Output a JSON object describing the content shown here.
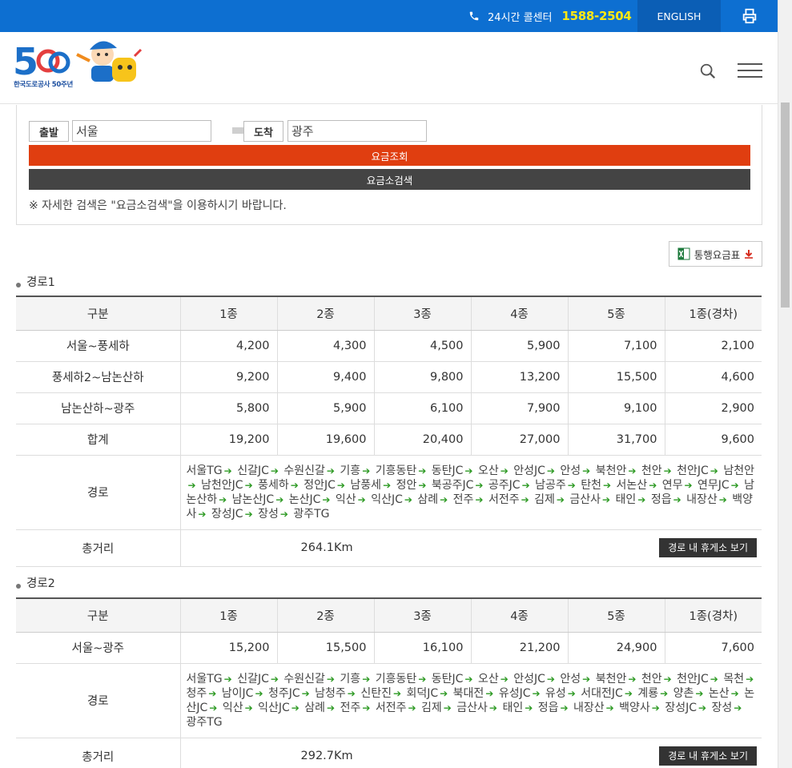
{
  "topbar": {
    "call_label": "24시간 콜센터",
    "call_number": "1588-2504",
    "english": "ENGLISH",
    "print_icon": "printer-icon"
  },
  "header": {
    "logo_alt": "한국도로공사 50주년",
    "search_icon": "search-icon",
    "menu_icon": "hamburger-menu-icon"
  },
  "search": {
    "depart_label": "출발",
    "depart_value": "서울",
    "arrive_label": "도착",
    "arrive_value": "광주",
    "fare_button": "요금조회",
    "toll_button": "요금소검색",
    "notice": "※ 자세한 검색은 \"요금소검색\"을 이용하시기 바랍니다."
  },
  "fare_table_button": "통행요금표",
  "headers": [
    "구분",
    "1종",
    "2종",
    "3종",
    "4종",
    "5종",
    "1종(경차)"
  ],
  "routes": [
    {
      "title": "경로1",
      "rows": [
        {
          "label": "서울~풍세하",
          "values": [
            "4,200",
            "4,300",
            "4,500",
            "5,900",
            "7,100",
            "2,100"
          ]
        },
        {
          "label": "풍세하2~남논산하",
          "values": [
            "9,200",
            "9,400",
            "9,800",
            "13,200",
            "15,500",
            "4,600"
          ]
        },
        {
          "label": "남논산하~광주",
          "values": [
            "5,800",
            "5,900",
            "6,100",
            "7,900",
            "9,100",
            "2,900"
          ]
        },
        {
          "label": "합계",
          "values": [
            "19,200",
            "19,600",
            "20,400",
            "27,000",
            "31,700",
            "9,600"
          ]
        }
      ],
      "path_label": "경로",
      "path": [
        "서울TG",
        "신갈JC",
        "수원신갈",
        "기흥",
        "기흥동탄",
        "동탄JC",
        "오산",
        "안성JC",
        "안성",
        "북천안",
        "천안",
        "천안JC",
        "남천안",
        "남천안JC",
        "풍세하",
        "정안JC",
        "남풍세",
        "정안",
        "북공주JC",
        "공주JC",
        "남공주",
        "탄천",
        "서논산",
        "연무",
        "연무JC",
        "남논산하",
        "남논산JC",
        "논산JC",
        "익산",
        "익산JC",
        "삼례",
        "전주",
        "서전주",
        "김제",
        "금산사",
        "태인",
        "정읍",
        "내장산",
        "백양사",
        "장성JC",
        "장성",
        "광주TG"
      ],
      "distance_label": "총거리",
      "distance": "264.1Km",
      "rest_button": "경로 내 휴게소 보기"
    },
    {
      "title": "경로2",
      "rows": [
        {
          "label": "서울~광주",
          "values": [
            "15,200",
            "15,500",
            "16,100",
            "21,200",
            "24,900",
            "7,600"
          ]
        }
      ],
      "path_label": "경로",
      "path": [
        "서울TG",
        "신갈JC",
        "수원신갈",
        "기흥",
        "기흥동탄",
        "동탄JC",
        "오산",
        "안성JC",
        "안성",
        "북천안",
        "천안",
        "천안JC",
        "목천",
        "청주",
        "남이JC",
        "청주JC",
        "남청주",
        "신탄진",
        "회덕JC",
        "북대전",
        "유성JC",
        "유성",
        "서대전JC",
        "계룡",
        "양촌",
        "논산",
        "논산JC",
        "익산",
        "익산JC",
        "삼례",
        "전주",
        "서전주",
        "김제",
        "금산사",
        "태인",
        "정읍",
        "내장산",
        "백양사",
        "장성JC",
        "장성",
        "광주TG"
      ],
      "distance_label": "총거리",
      "distance": "292.7Km",
      "rest_button": "경로 내 휴게소 보기"
    }
  ],
  "colors": {
    "topbar": "#0d6fd1",
    "call_number": "#ffe812",
    "fare_button": "#e03e10",
    "toll_button": "#444444",
    "arrow": "#2e9a24"
  }
}
